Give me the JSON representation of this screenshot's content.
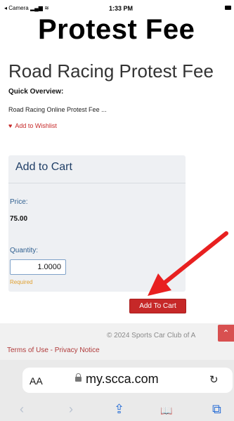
{
  "status_bar": {
    "back_app": "◂ Camera",
    "signal": "▂▄▆",
    "wifi": "≋",
    "time": "1:33 PM"
  },
  "banner": {
    "title": "Protest Fee"
  },
  "product": {
    "title": "Road Racing Protest Fee",
    "overview_label": "Quick Overview:",
    "overview_text": "Road Racing Online Protest Fee ...",
    "wishlist_icon": "♥",
    "wishlist_label": "Add to Wishlist"
  },
  "cart": {
    "heading": "Add to Cart",
    "price_label": "Price:",
    "price_value": "75.00",
    "quantity_label": "Quantity:",
    "quantity_value": "1.0000",
    "required_note": "Required",
    "add_button": "Add To Cart"
  },
  "footer": {
    "copyright": "© 2024 Sports Car Club of A",
    "scroll_top_icon": "⌃",
    "terms": "Terms of Use",
    "separator": " - ",
    "privacy": "Privacy Notice"
  },
  "browser": {
    "text_size": "AA",
    "url": "my.scca.com",
    "reload_icon": "↻",
    "back_icon": "‹",
    "forward_icon": "›",
    "share_icon": "⇪",
    "bookmarks_icon": "📖",
    "tabs_icon": "⧉"
  },
  "colors": {
    "accent_red": "#c62828",
    "link_blue": "#2f5f8f",
    "panel_bg": "#eef0f3"
  }
}
